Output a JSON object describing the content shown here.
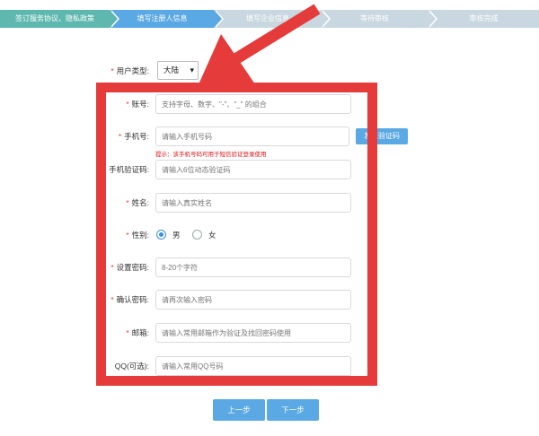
{
  "steps": [
    {
      "label": "签订服务协议、隐私政策",
      "state": "done"
    },
    {
      "label": "填写注册人信息",
      "state": "active"
    },
    {
      "label": "填写企业信息",
      "state": "todo"
    },
    {
      "label": "等待审核",
      "state": "todo"
    },
    {
      "label": "审核完成",
      "state": "todo"
    }
  ],
  "form": {
    "user_type": {
      "label": "用户类型:",
      "value": "大陆"
    },
    "account": {
      "label": "账号:",
      "placeholder": "支持字母、数字、\"-\"、\"_\" 的组合"
    },
    "phone": {
      "label": "手机号:",
      "placeholder": "请输入手机号码",
      "button": "发送验证码"
    },
    "hint": "提示：该手机号码可用于短信验证登录使用",
    "sms_code": {
      "label": "手机验证码:",
      "placeholder": "请输入6位动态验证码"
    },
    "name": {
      "label": "姓名:",
      "placeholder": "请输入真实姓名"
    },
    "gender": {
      "label": "性别:",
      "options": [
        "男",
        "女"
      ],
      "selected": "男"
    },
    "password": {
      "label": "设置密码:",
      "placeholder": "8-20个字符"
    },
    "confirm": {
      "label": "确认密码:",
      "placeholder": "请再次输入密码"
    },
    "email": {
      "label": "邮箱:",
      "placeholder": "请输入常用邮箱作为验证及找回密码使用"
    },
    "qq": {
      "label": "QQ(可选):",
      "placeholder": "请输入常用QQ号码"
    }
  },
  "buttons": {
    "prev": "上一步",
    "next": "下一步"
  },
  "colors": {
    "step_done": "#5fb8b0",
    "step_active": "#5aa8e4",
    "step_todo": "#c9d7e0",
    "annotation_red": "#e53b3b",
    "primary": "#5aa8e4"
  }
}
